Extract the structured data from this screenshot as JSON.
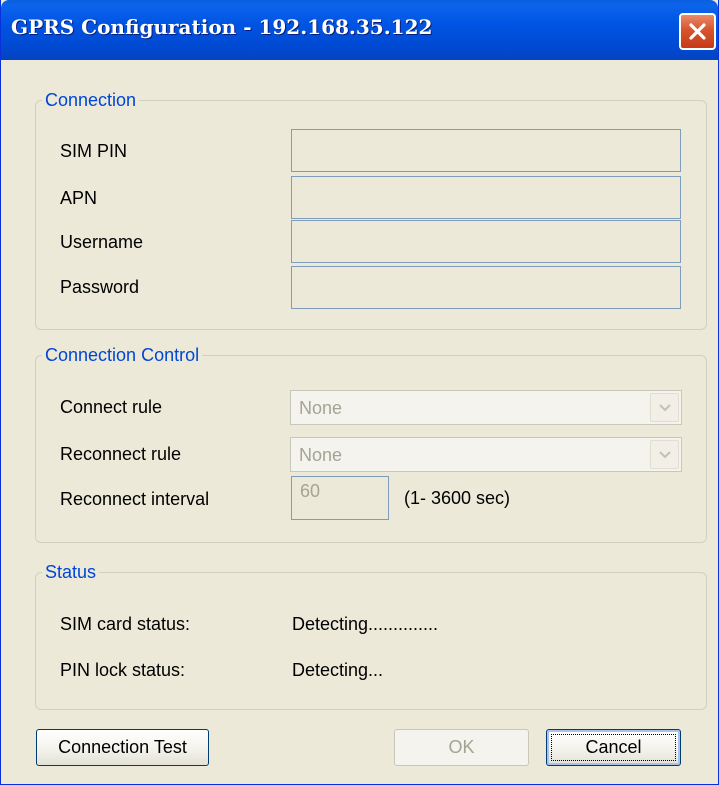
{
  "window": {
    "title": "GPRS Configuration - 192.168.35.122"
  },
  "connection": {
    "legend": "Connection",
    "sim_pin_label": "SIM PIN",
    "apn_label": "APN",
    "username_label": "Username",
    "password_label": "Password",
    "sim_pin_value": "",
    "apn_value": "",
    "username_value": "",
    "password_value": ""
  },
  "connection_control": {
    "legend": "Connection Control",
    "connect_rule_label": "Connect rule",
    "connect_rule_value": "None",
    "reconnect_rule_label": "Reconnect rule",
    "reconnect_rule_value": "None",
    "reconnect_interval_label": "Reconnect interval",
    "reconnect_interval_value": "60",
    "reconnect_interval_range": "(1- 3600 sec)"
  },
  "status": {
    "legend": "Status",
    "sim_card_label": "SIM card status:",
    "sim_card_value": "Detecting..............",
    "pin_lock_label": "PIN lock status:",
    "pin_lock_value": "Detecting..."
  },
  "buttons": {
    "connection_test": "Connection Test",
    "ok": "OK",
    "cancel": "Cancel"
  },
  "colors": {
    "titlebar": "#0054e3",
    "dialog_bg": "#ece9d8",
    "group_legend": "#0046d5",
    "disabled_text": "#a5a393",
    "close_button": "#d9542c"
  }
}
